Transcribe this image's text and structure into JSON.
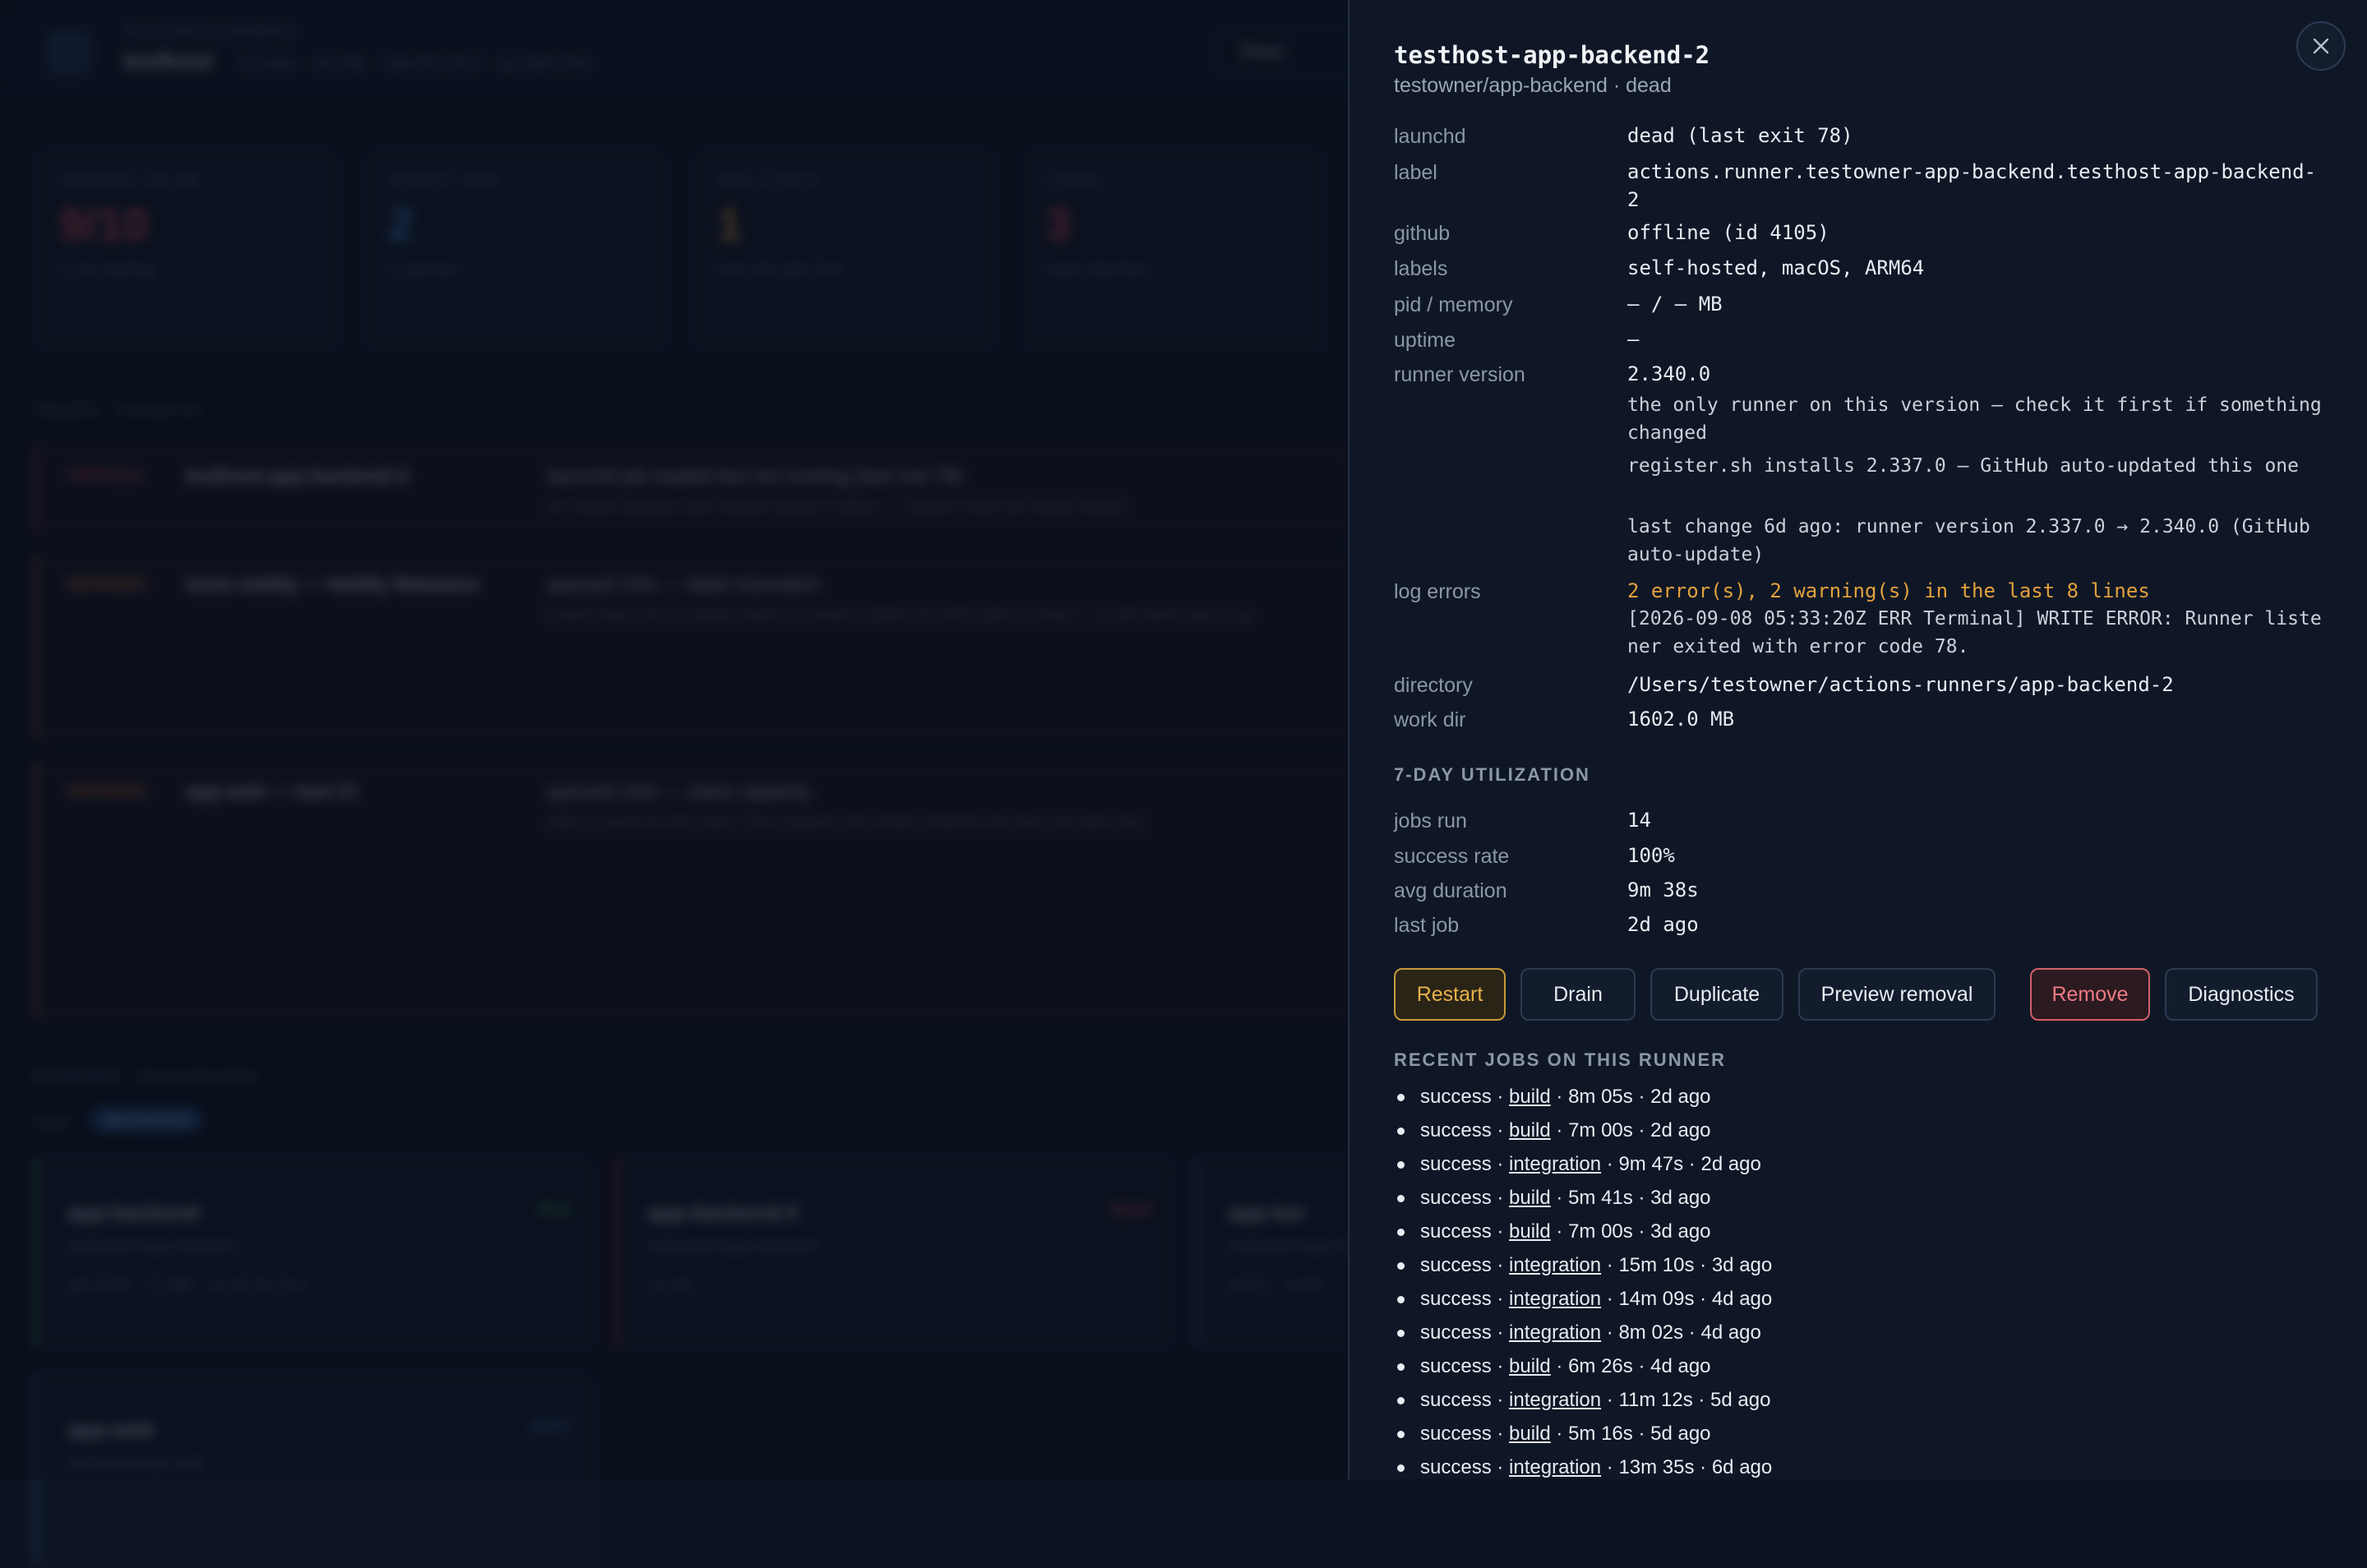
{
  "drawer": {
    "title": "testhost-app-backend-2",
    "subtitle": "testowner/app-backend · dead",
    "details": [
      {
        "key": "launchd",
        "value": "dead (last exit 78)"
      },
      {
        "key": "label",
        "value": "actions.runner.testowner-app-backend.testhost-app-backend-2"
      },
      {
        "key": "github",
        "value": "offline (id 4105)"
      },
      {
        "key": "labels",
        "value": "self-hosted, macOS, ARM64"
      },
      {
        "key": "pid / memory",
        "value": "— / — MB"
      },
      {
        "key": "uptime",
        "value": "—"
      },
      {
        "key": "runner version",
        "value": "2.340.0"
      }
    ],
    "runner_version_notes": [
      "the only runner on this version — check it first if something changed",
      "register.sh installs 2.337.0 — GitHub auto-updated this one",
      "last change 6d ago: runner version 2.337.0 → 2.340.0 (GitHub auto-update)"
    ],
    "log_errors": {
      "key": "log errors",
      "summary": "2 error(s), 2 warning(s) in the last 8 lines",
      "line": "[2026-09-08 05:33:20Z ERR Terminal] WRITE ERROR: Runner listener exited with error code 78."
    },
    "directory": {
      "key": "directory",
      "value": "/Users/testowner/actions-runners/app-backend-2"
    },
    "work_dir": {
      "key": "work dir",
      "value": "1602.0 MB"
    },
    "utilization": {
      "title": "7-DAY UTILIZATION",
      "rows": [
        {
          "key": "jobs run",
          "value": "14"
        },
        {
          "key": "success rate",
          "value": "100%"
        },
        {
          "key": "avg duration",
          "value": "9m 38s"
        },
        {
          "key": "last job",
          "value": "2d ago"
        }
      ]
    },
    "actions": {
      "restart": "Restart",
      "drain": "Drain",
      "duplicate": "Duplicate",
      "preview_removal": "Preview removal",
      "remove": "Remove",
      "diagnostics": "Diagnostics"
    },
    "recent_jobs": {
      "title": "RECENT JOBS ON THIS RUNNER",
      "items": [
        {
          "status": "success",
          "job": "build",
          "duration": "8m 05s",
          "ago": "2d ago"
        },
        {
          "status": "success",
          "job": "build",
          "duration": "7m 00s",
          "ago": "2d ago"
        },
        {
          "status": "success",
          "job": "integration",
          "duration": "9m 47s",
          "ago": "2d ago"
        },
        {
          "status": "success",
          "job": "build",
          "duration": "5m 41s",
          "ago": "3d ago"
        },
        {
          "status": "success",
          "job": "build",
          "duration": "7m 00s",
          "ago": "3d ago"
        },
        {
          "status": "success",
          "job": "integration",
          "duration": "15m 10s",
          "ago": "3d ago"
        },
        {
          "status": "success",
          "job": "integration",
          "duration": "14m 09s",
          "ago": "4d ago"
        },
        {
          "status": "success",
          "job": "integration",
          "duration": "8m 02s",
          "ago": "4d ago"
        },
        {
          "status": "success",
          "job": "build",
          "duration": "6m 26s",
          "ago": "4d ago"
        },
        {
          "status": "success",
          "job": "integration",
          "duration": "11m 12s",
          "ago": "5d ago"
        },
        {
          "status": "success",
          "job": "build",
          "duration": "5m 16s",
          "ago": "5d ago"
        },
        {
          "status": "success",
          "job": "integration",
          "duration": "13m 35s",
          "ago": "6d ago"
        }
      ]
    },
    "close_icon": "close-icon"
  },
  "background": {
    "brand_sub": "ACTIONS RUNNERS",
    "host": "testhost",
    "host_meta": "8 cores · 16 GB · macOS 26.0 · up 38d 7hrs",
    "fleet_tab": "Fleet",
    "stats": [
      {
        "label": "RUNNERS ONLINE",
        "value": "9/10",
        "hint": "1 not starting",
        "color": "#e0505c"
      },
      {
        "label": "BUSIEST NOW",
        "value": "2",
        "hint": "2 queued",
        "color": "#4a8fe0"
      },
      {
        "label": "DISK ALERTS",
        "value": "1",
        "hint": "over the alert line",
        "color": "#e3a13d"
      },
      {
        "label": "ISSUES",
        "value": "3",
        "hint": "need attention",
        "color": "#e0505c"
      }
    ],
    "alerts_head": "ISSUES · 3 to act on",
    "alerts": [
      {
        "sev": "CRITICAL",
        "who": "testhost-app-backend-2",
        "what": "launchd job loaded but not running (last exit 78)",
        "why": "no runner process and GitHub shows it offline — restart it with the restart button",
        "color": "#e0505c"
      },
      {
        "sev": "WARNING",
        "who": "tools-netlify — Netlify Releases",
        "what": "queued 23m — label mismatch",
        "why": "Check that runs-on labels match a runner's labels. Do NOT add a runner — it will never pick it up.",
        "color": "#e07a3d"
      },
      {
        "sev": "WARNING",
        "who": "app-web — test CI",
        "what": "queued 14m — class capacity",
        "why": "Add a runner for this repo. The Capacity tab shows whether the host can take one.",
        "color": "#e07a3d"
      }
    ],
    "runners_head": "RUNNERS · 10 on this host",
    "filter_label": "repo",
    "filter_chip": "app-backend",
    "cards": [
      {
        "name": "app-backend",
        "repo": "testowner/app-backend",
        "meta": "pid 4128 · 71 MB · up 4d 3h 11m",
        "badge": "IDLE",
        "color": "#3fb950"
      },
      {
        "name": "app-backend-2",
        "repo": "testowner/app-backend",
        "meta": "no pid",
        "badge": "DEAD",
        "color": "#e0505c"
      },
      {
        "name": "app-lon",
        "repo": "testowner/app-lon",
        "meta": "pid 51 · build",
        "badge": "",
        "color": "#4a8fe0"
      },
      {
        "name": "app-web",
        "repo": "testowner/app-web",
        "meta": "",
        "badge": "BUSY",
        "color": "#4a8fe0"
      }
    ]
  }
}
